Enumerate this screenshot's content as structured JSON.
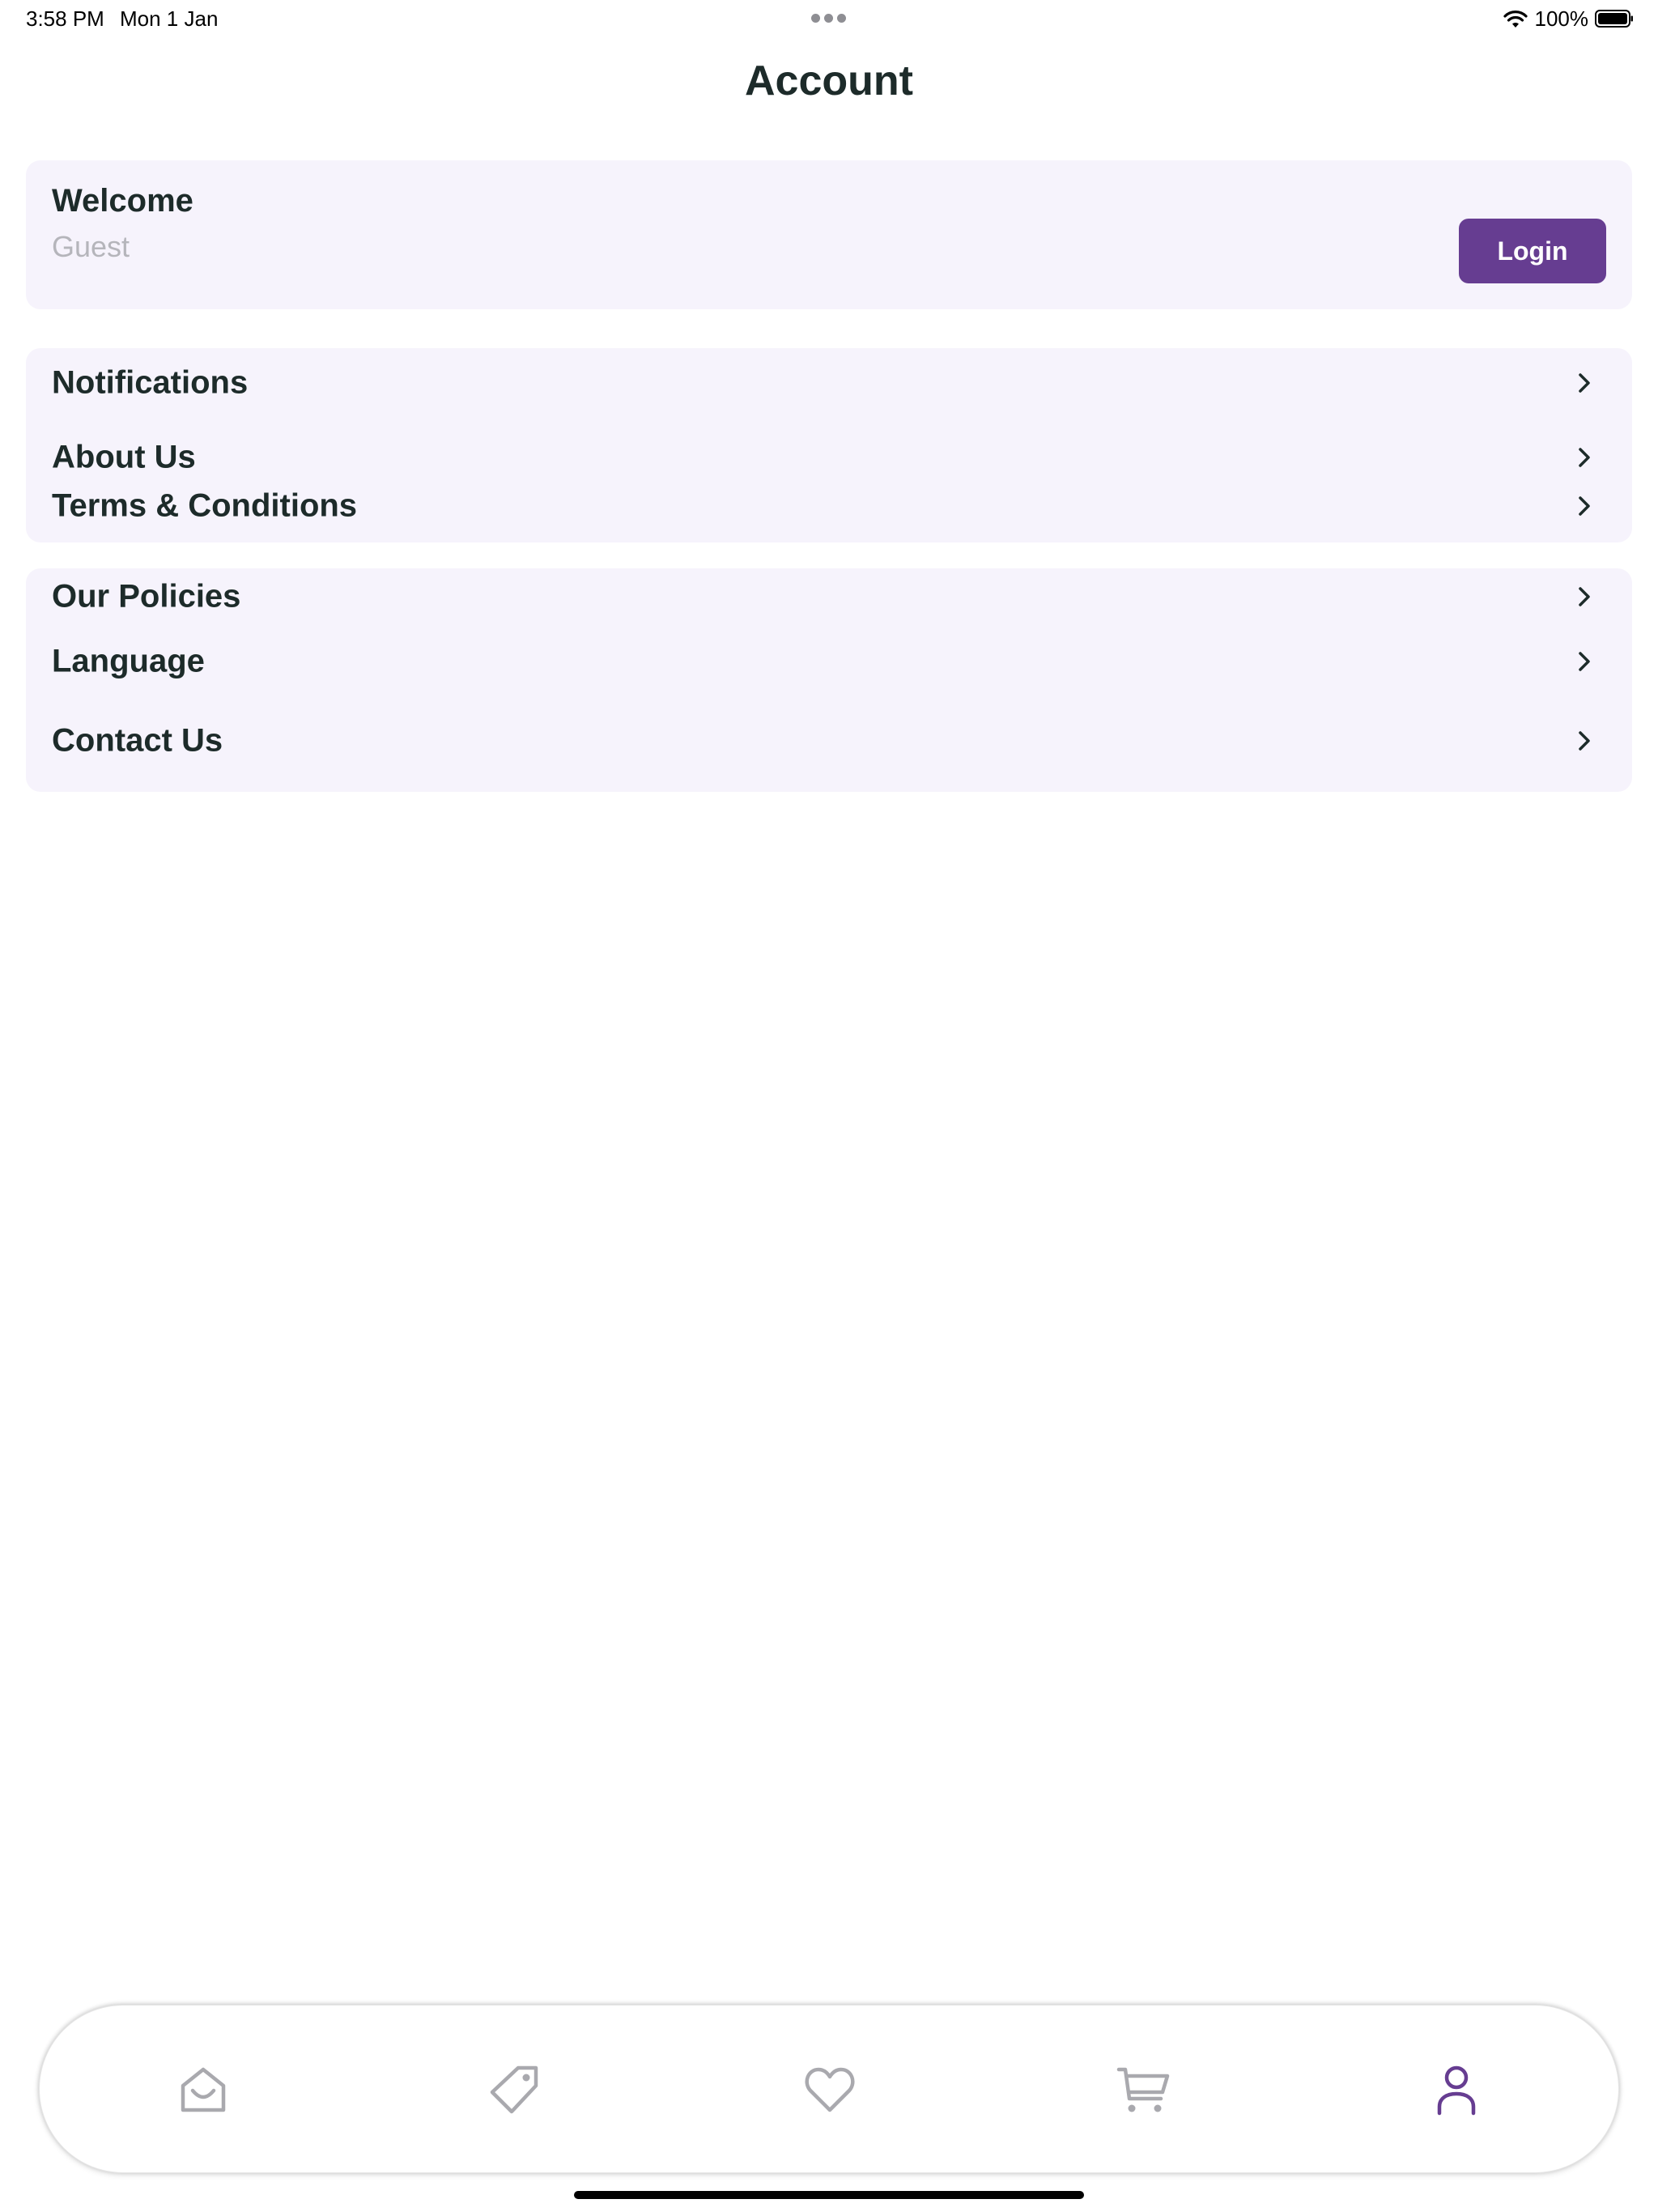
{
  "status_bar": {
    "time": "3:58 PM",
    "date": "Mon 1 Jan",
    "battery": "100%"
  },
  "page": {
    "title": "Account"
  },
  "welcome": {
    "title": "Welcome",
    "subtitle": "Guest",
    "login_label": "Login"
  },
  "menu_group_1": [
    {
      "label": "Notifications"
    },
    {
      "label": "About Us"
    },
    {
      "label": "Terms & Conditions"
    }
  ],
  "menu_group_2": [
    {
      "label": "Our Policies"
    },
    {
      "label": "Language"
    },
    {
      "label": "Contact Us"
    }
  ],
  "tab_bar": {
    "tabs": [
      {
        "icon": "home-icon",
        "active": false
      },
      {
        "icon": "tag-icon",
        "active": false
      },
      {
        "icon": "heart-icon",
        "active": false
      },
      {
        "icon": "cart-icon",
        "active": false
      },
      {
        "icon": "user-icon",
        "active": true
      }
    ]
  },
  "colors": {
    "accent": "#663d91",
    "card_bg": "#f6f3fc",
    "text": "#1d2b2a",
    "muted": "#b5b5bb",
    "inactive_icon": "#a9a9ae"
  }
}
